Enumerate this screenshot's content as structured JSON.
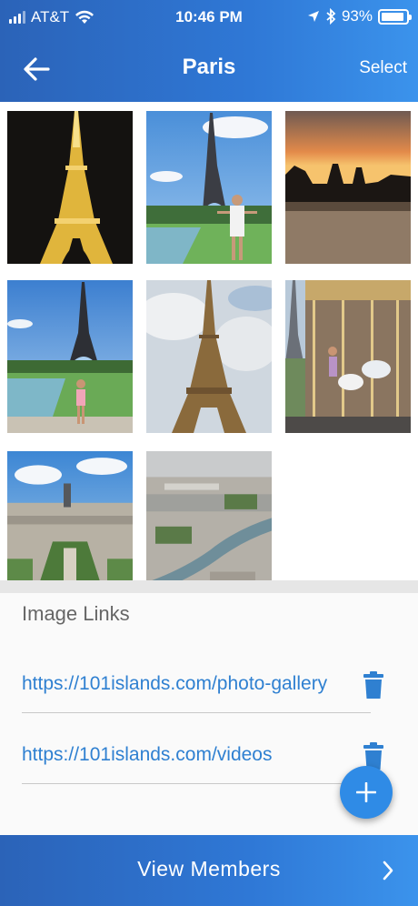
{
  "status_bar": {
    "carrier": "AT&T",
    "time": "10:46 PM",
    "battery_percent": "93%",
    "battery_level": 0.93
  },
  "nav": {
    "title": "Paris",
    "select_label": "Select"
  },
  "photos": [
    {
      "subject": "eiffel-tower-night"
    },
    {
      "subject": "eiffel-tower-person-trocadero"
    },
    {
      "subject": "notre-dame-sunset"
    },
    {
      "subject": "eiffel-tower-girl-trocadero"
    },
    {
      "subject": "eiffel-tower-from-below"
    },
    {
      "subject": "carousel-eiffel-tower"
    },
    {
      "subject": "paris-skyline-champ-de-mars"
    },
    {
      "subject": "paris-aerial-seine"
    }
  ],
  "links": {
    "heading": "Image Links",
    "items": [
      {
        "url": "https://101islands.com/photo-gallery"
      },
      {
        "url": "https://101islands.com/videos"
      }
    ]
  },
  "bottom": {
    "label": "View Members"
  },
  "colors": {
    "primary": "#2f78d6",
    "link": "#2f80d1",
    "fab": "#2f8be6"
  }
}
